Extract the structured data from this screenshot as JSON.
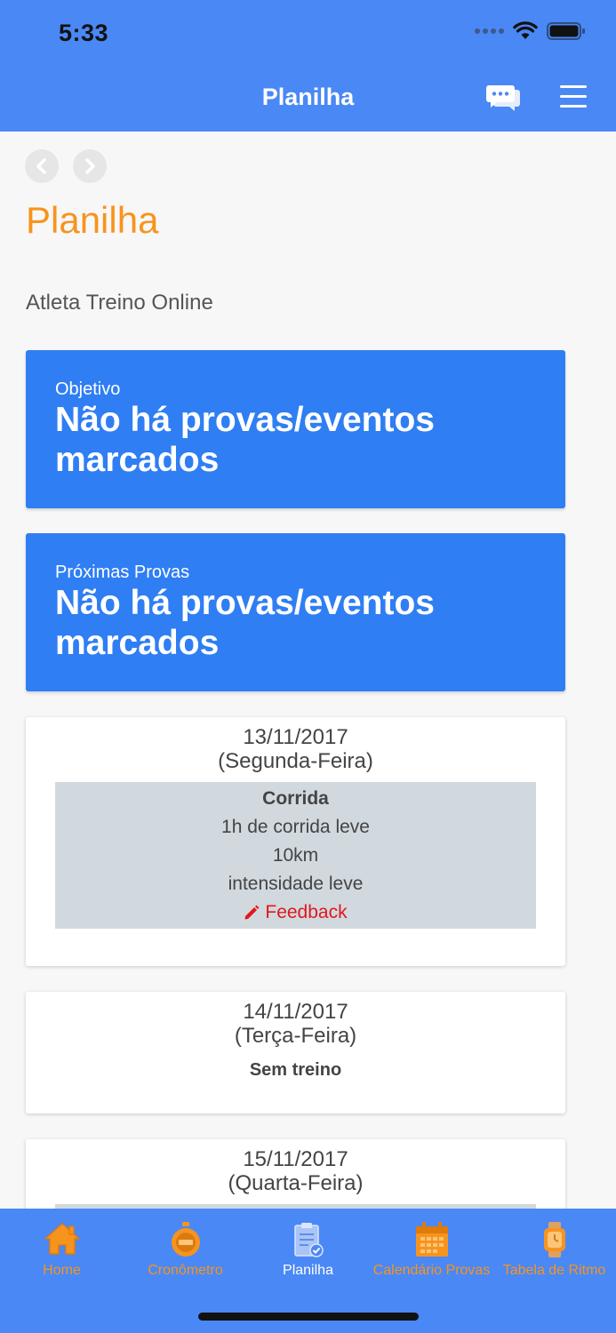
{
  "status_bar": {
    "time": "5:33"
  },
  "nav": {
    "title": "Planilha"
  },
  "page": {
    "title": "Planilha",
    "athlete": "Atleta Treino Online"
  },
  "cards": {
    "objective": {
      "label": "Objetivo",
      "value": "Não há provas/eventos marcados"
    },
    "next_races": {
      "label": "Próximas Provas",
      "value": "Não há provas/eventos marcados"
    }
  },
  "days": [
    {
      "date": "13/11/2017",
      "weekday": "(Segunda-Feira)",
      "workout": {
        "type": "Corrida",
        "lines": [
          "1h de corrida leve",
          "10km",
          "intensidade leve"
        ],
        "feedback": "Feedback"
      }
    },
    {
      "date": "14/11/2017",
      "weekday": "(Terça-Feira)",
      "note": "Sem treino"
    },
    {
      "date": "15/11/2017",
      "weekday": "(Quarta-Feira)"
    }
  ],
  "tabs": [
    {
      "label": "Home",
      "icon": "home-icon"
    },
    {
      "label": "Cronômetro",
      "icon": "stopwatch-icon"
    },
    {
      "label": "Planilha",
      "icon": "clipboard-icon",
      "active": true
    },
    {
      "label": "Calendário Provas",
      "icon": "calendar-icon"
    },
    {
      "label": "Tabela de Ritmo",
      "icon": "smartwatch-icon"
    }
  ],
  "colors": {
    "header": "#4a88f5",
    "card_blue": "#2f7ef3",
    "accent_orange": "#f7941d",
    "feedback_red": "#e0181e",
    "workout_bg": "#d1d9de"
  }
}
